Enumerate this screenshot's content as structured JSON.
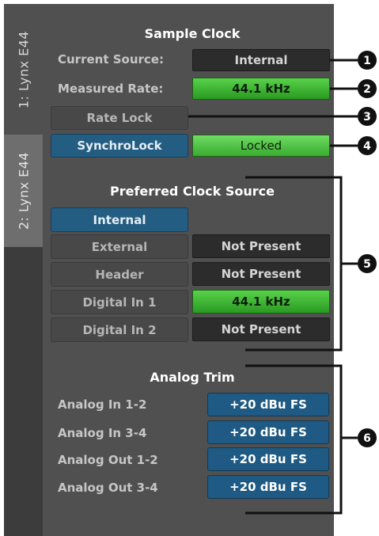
{
  "tabs": [
    {
      "label": "1: Lynx E44",
      "active": true
    },
    {
      "label": "2: Lynx E44",
      "active": false
    }
  ],
  "sample_clock": {
    "title": "Sample Clock",
    "current_source_label": "Current Source:",
    "current_source_value": "Internal",
    "measured_rate_label": "Measured Rate:",
    "measured_rate_value": "44.1 kHz",
    "rate_lock_label": "Rate Lock",
    "synchrolock_label": "SynchroLock",
    "synchrolock_status": "Locked"
  },
  "preferred_clock_source": {
    "title": "Preferred Clock Source",
    "options": [
      {
        "label": "Internal",
        "status": "",
        "selected": true
      },
      {
        "label": "External",
        "status": "Not Present",
        "selected": false
      },
      {
        "label": "Header",
        "status": "Not Present",
        "selected": false
      },
      {
        "label": "Digital In 1",
        "status": "44.1 kHz",
        "selected": false
      },
      {
        "label": "Digital In 2",
        "status": "Not Present",
        "selected": false
      }
    ]
  },
  "analog_trim": {
    "title": "Analog Trim",
    "rows": [
      {
        "label": "Analog In 1-2",
        "value": "+20 dBu FS"
      },
      {
        "label": "Analog In 3-4",
        "value": "+20 dBu FS"
      },
      {
        "label": "Analog Out 1-2",
        "value": "+20 dBu FS"
      },
      {
        "label": "Analog Out 3-4",
        "value": "+20 dBu FS"
      }
    ]
  },
  "callouts": [
    "1",
    "2",
    "3",
    "4",
    "5",
    "6"
  ],
  "colors": {
    "panel": "#505050",
    "display_green": "#3fb834",
    "button_blue": "#245d82",
    "trim_blue": "#1e5a83",
    "callout": "#111111"
  }
}
